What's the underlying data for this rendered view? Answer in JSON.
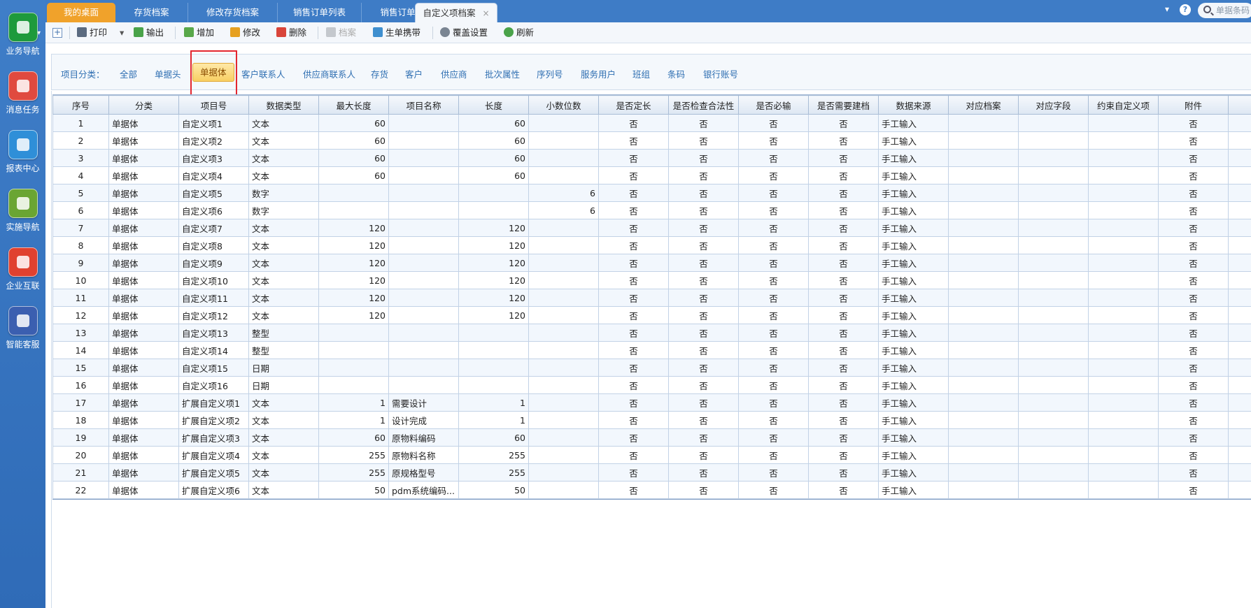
{
  "sidebar": {
    "items": [
      {
        "label": "业务导航",
        "icon": "business-nav-icon",
        "color": "#1e9a3c"
      },
      {
        "label": "消息任务",
        "icon": "message-task-icon",
        "color": "#e04a3f"
      },
      {
        "label": "报表中心",
        "icon": "report-center-icon",
        "color": "#2f8fd8"
      },
      {
        "label": "实施导航",
        "icon": "implementation-nav-icon",
        "color": "#6aa533"
      },
      {
        "label": "企业互联",
        "icon": "enterprise-link-icon",
        "color": "#e0412f"
      },
      {
        "label": "智能客服",
        "icon": "smart-service-icon",
        "color": "#3b5fb0"
      }
    ]
  },
  "tabs": [
    {
      "label": "我的桌面"
    },
    {
      "label": "存货档案"
    },
    {
      "label": "修改存货档案"
    },
    {
      "label": "销售订单列表"
    },
    {
      "label": "销售订单"
    },
    {
      "label": "自定义项档案",
      "close": "×"
    }
  ],
  "header": {
    "dropdown_caret": "▾",
    "help": "?",
    "search_placeholder": "单据条码"
  },
  "toolbar": {
    "expand": "+",
    "print": "打印",
    "print_caret": "▾",
    "export": "输出",
    "add": "增加",
    "edit": "修改",
    "delete": "删除",
    "archive": "档案",
    "generate": "生单携带",
    "override": "覆盖设置",
    "refresh": "刷新"
  },
  "category": {
    "label": "项目分类：",
    "items": [
      "全部",
      "单据头",
      "单据体",
      "客户联系人",
      "供应商联系人",
      "存货",
      "客户",
      "供应商",
      "批次属性",
      "序列号",
      "服务用户",
      "班组",
      "条码",
      "银行账号"
    ],
    "active": "单据体"
  },
  "grid": {
    "columns": [
      "序号",
      "分类",
      "项目号",
      "数据类型",
      "最大长度",
      "项目名称",
      "长度",
      "小数位数",
      "是否定长",
      "是否检查合法性",
      "是否必输",
      "是否需要建档",
      "数据来源",
      "对应档案",
      "对应字段",
      "约束自定义项",
      "附件",
      ""
    ],
    "rows": [
      [
        "1",
        "单据体",
        "自定义项1",
        "文本",
        "60",
        "",
        "60",
        "",
        "否",
        "否",
        "否",
        "否",
        "手工输入",
        "",
        "",
        "",
        "否"
      ],
      [
        "2",
        "单据体",
        "自定义项2",
        "文本",
        "60",
        "",
        "60",
        "",
        "否",
        "否",
        "否",
        "否",
        "手工输入",
        "",
        "",
        "",
        "否"
      ],
      [
        "3",
        "单据体",
        "自定义项3",
        "文本",
        "60",
        "",
        "60",
        "",
        "否",
        "否",
        "否",
        "否",
        "手工输入",
        "",
        "",
        "",
        "否"
      ],
      [
        "4",
        "单据体",
        "自定义项4",
        "文本",
        "60",
        "",
        "60",
        "",
        "否",
        "否",
        "否",
        "否",
        "手工输入",
        "",
        "",
        "",
        "否"
      ],
      [
        "5",
        "单据体",
        "自定义项5",
        "数字",
        "",
        "",
        "",
        "6",
        "否",
        "否",
        "否",
        "否",
        "手工输入",
        "",
        "",
        "",
        "否"
      ],
      [
        "6",
        "单据体",
        "自定义项6",
        "数字",
        "",
        "",
        "",
        "6",
        "否",
        "否",
        "否",
        "否",
        "手工输入",
        "",
        "",
        "",
        "否"
      ],
      [
        "7",
        "单据体",
        "自定义项7",
        "文本",
        "120",
        "",
        "120",
        "",
        "否",
        "否",
        "否",
        "否",
        "手工输入",
        "",
        "",
        "",
        "否"
      ],
      [
        "8",
        "单据体",
        "自定义项8",
        "文本",
        "120",
        "",
        "120",
        "",
        "否",
        "否",
        "否",
        "否",
        "手工输入",
        "",
        "",
        "",
        "否"
      ],
      [
        "9",
        "单据体",
        "自定义项9",
        "文本",
        "120",
        "",
        "120",
        "",
        "否",
        "否",
        "否",
        "否",
        "手工输入",
        "",
        "",
        "",
        "否"
      ],
      [
        "10",
        "单据体",
        "自定义项10",
        "文本",
        "120",
        "",
        "120",
        "",
        "否",
        "否",
        "否",
        "否",
        "手工输入",
        "",
        "",
        "",
        "否"
      ],
      [
        "11",
        "单据体",
        "自定义项11",
        "文本",
        "120",
        "",
        "120",
        "",
        "否",
        "否",
        "否",
        "否",
        "手工输入",
        "",
        "",
        "",
        "否"
      ],
      [
        "12",
        "单据体",
        "自定义项12",
        "文本",
        "120",
        "",
        "120",
        "",
        "否",
        "否",
        "否",
        "否",
        "手工输入",
        "",
        "",
        "",
        "否"
      ],
      [
        "13",
        "单据体",
        "自定义项13",
        "整型",
        "",
        "",
        "",
        "",
        "否",
        "否",
        "否",
        "否",
        "手工输入",
        "",
        "",
        "",
        "否"
      ],
      [
        "14",
        "单据体",
        "自定义项14",
        "整型",
        "",
        "",
        "",
        "",
        "否",
        "否",
        "否",
        "否",
        "手工输入",
        "",
        "",
        "",
        "否"
      ],
      [
        "15",
        "单据体",
        "自定义项15",
        "日期",
        "",
        "",
        "",
        "",
        "否",
        "否",
        "否",
        "否",
        "手工输入",
        "",
        "",
        "",
        "否"
      ],
      [
        "16",
        "单据体",
        "自定义项16",
        "日期",
        "",
        "",
        "",
        "",
        "否",
        "否",
        "否",
        "否",
        "手工输入",
        "",
        "",
        "",
        "否"
      ],
      [
        "17",
        "单据体",
        "扩展自定义项1",
        "文本",
        "1",
        "需要设计",
        "1",
        "",
        "否",
        "否",
        "否",
        "否",
        "手工输入",
        "",
        "",
        "",
        "否"
      ],
      [
        "18",
        "单据体",
        "扩展自定义项2",
        "文本",
        "1",
        "设计完成",
        "1",
        "",
        "否",
        "否",
        "否",
        "否",
        "手工输入",
        "",
        "",
        "",
        "否"
      ],
      [
        "19",
        "单据体",
        "扩展自定义项3",
        "文本",
        "60",
        "原物料编码",
        "60",
        "",
        "否",
        "否",
        "否",
        "否",
        "手工输入",
        "",
        "",
        "",
        "否"
      ],
      [
        "20",
        "单据体",
        "扩展自定义项4",
        "文本",
        "255",
        "原物料名称",
        "255",
        "",
        "否",
        "否",
        "否",
        "否",
        "手工输入",
        "",
        "",
        "",
        "否"
      ],
      [
        "21",
        "单据体",
        "扩展自定义项5",
        "文本",
        "255",
        "原规格型号",
        "255",
        "",
        "否",
        "否",
        "否",
        "否",
        "手工输入",
        "",
        "",
        "",
        "否"
      ],
      [
        "22",
        "单据体",
        "扩展自定义项6",
        "文本",
        "50",
        "pdm系统编码...",
        "50",
        "",
        "否",
        "否",
        "否",
        "否",
        "手工输入",
        "",
        "",
        "",
        "否"
      ]
    ]
  },
  "colors": {
    "home_tab": "#f0a22b",
    "tabbar": "#3e7cc6",
    "active_category": "#f8cf63",
    "highlight_box": "#e3262f"
  }
}
